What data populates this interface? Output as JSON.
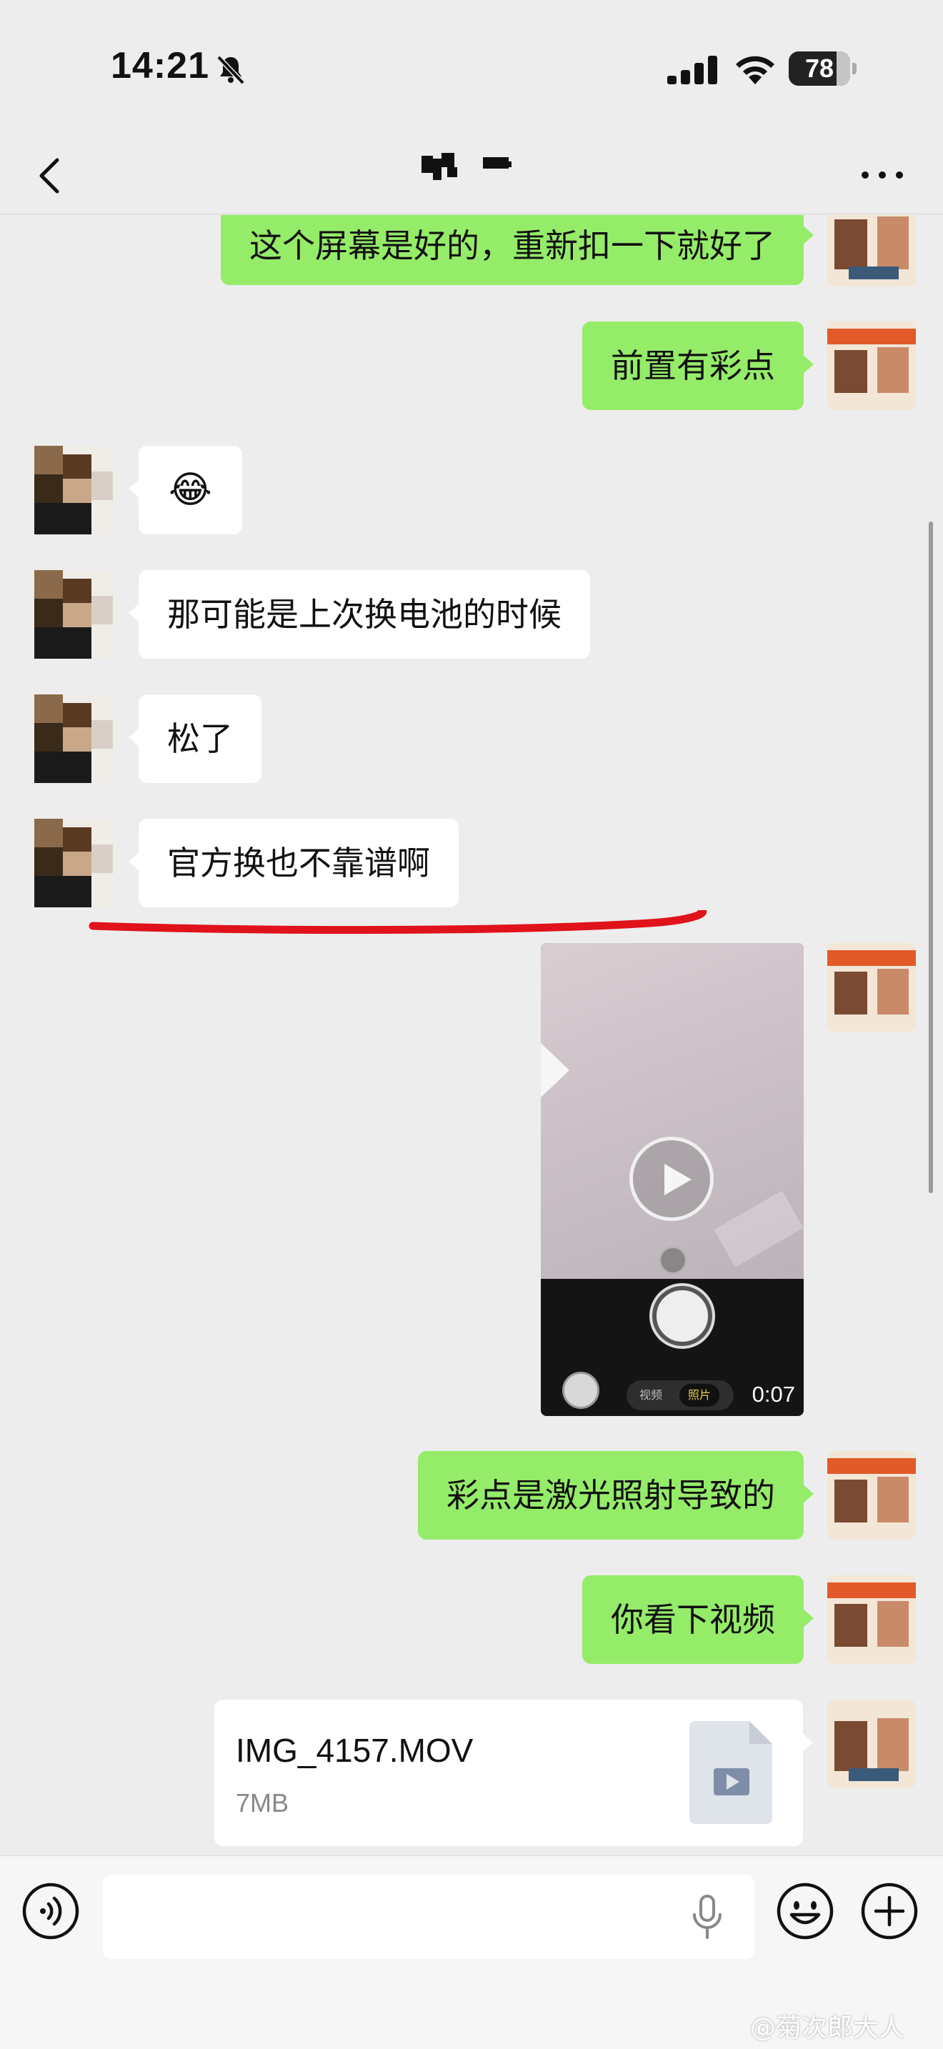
{
  "status_bar": {
    "time": "14:21",
    "battery_level": "78",
    "battery_fraction": 0.78,
    "icons": [
      "bell-slash-icon",
      "cellular-signal-icon",
      "wifi-icon",
      "battery-icon"
    ]
  },
  "nav": {
    "back_icon": "chevron-left-icon",
    "more_icon": "more-dots-icon"
  },
  "messages": [
    {
      "side": "right",
      "type": "text",
      "text": "这个屏幕是好的，重新扣一下就好了"
    },
    {
      "side": "right",
      "type": "text",
      "text": "前置有彩点"
    },
    {
      "side": "left",
      "type": "emoji",
      "text": "😂",
      "emoji_name": "tears-of-joy"
    },
    {
      "side": "left",
      "type": "text",
      "text": "那可能是上次换电池的时候"
    },
    {
      "side": "left",
      "type": "text",
      "text": "松了"
    },
    {
      "side": "left",
      "type": "text",
      "text": "官方换也不靠谱啊"
    },
    {
      "side": "right",
      "type": "video",
      "duration": "0:07",
      "modes": [
        "视频",
        "照片"
      ]
    },
    {
      "side": "right",
      "type": "text",
      "text": "彩点是激光照射导致的"
    },
    {
      "side": "right",
      "type": "text",
      "text": "你看下视频"
    },
    {
      "side": "right",
      "type": "file",
      "file_name": "IMG_4157.MOV",
      "file_size": "7MB",
      "file_icon": "video-file-icon"
    }
  ],
  "annotation": {
    "type": "red-underline",
    "color": "#e0121a"
  },
  "input_bar": {
    "placeholder": "",
    "voice_icon": "voice-icon",
    "mic_icon": "microphone-icon",
    "emoji_icon": "smiley-icon",
    "plus_icon": "plus-circle-icon"
  },
  "watermark": "@菊次郎大人",
  "colors": {
    "background": "#ededed",
    "my_bubble": "#95ec69",
    "their_bubble": "#ffffff",
    "annotation_red": "#e0121a"
  }
}
